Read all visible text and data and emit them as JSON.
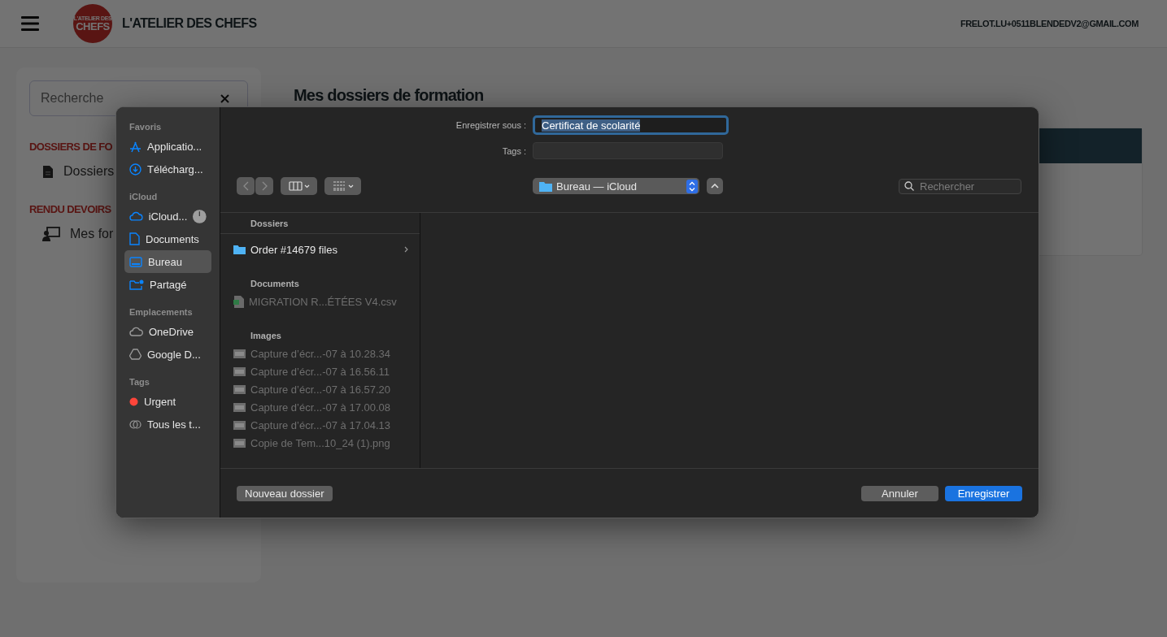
{
  "header": {
    "logo": {
      "line1": "L'ATELIER DES",
      "line2": "CHEFS"
    },
    "title": "L'ATELIER DES CHEFS",
    "email": "FRELOT.LU+0511BLENDEDV2@GMAIL.COM"
  },
  "sidebar": {
    "search": {
      "placeholder": "Recherche"
    },
    "sections": [
      {
        "title": "DOSSIERS DE FO",
        "items": [
          {
            "label": "Dossiers",
            "kind": "document"
          }
        ]
      },
      {
        "title": "RENDU DEVOIRS",
        "items": [
          {
            "label": "Mes for",
            "kind": "teacher"
          }
        ]
      }
    ]
  },
  "main": {
    "title": "Mes dossiers de formation"
  },
  "dialog": {
    "save_as": {
      "label": "Enregistrer sous :",
      "value": "Certificat de scolarité",
      "text_selected": true
    },
    "tags": {
      "label": "Tags :"
    },
    "location": "Bureau — iCloud",
    "search": {
      "placeholder": "Rechercher"
    },
    "places": [
      {
        "title": "Favoris",
        "items": [
          {
            "label": "Applicatio...",
            "kind": "apps",
            "selected": false
          },
          {
            "label": "Télécharg...",
            "kind": "download",
            "selected": false
          }
        ]
      },
      {
        "title": "iCloud",
        "items": [
          {
            "label": "iCloud...",
            "kind": "cloud",
            "selected": false,
            "progress": true
          },
          {
            "label": "Documents",
            "kind": "document",
            "selected": false
          },
          {
            "label": "Bureau",
            "kind": "desktop",
            "selected": true
          },
          {
            "label": "Partagé",
            "kind": "shared",
            "selected": false
          }
        ]
      },
      {
        "title": "Emplacements",
        "items": [
          {
            "label": "OneDrive",
            "kind": "cloud-grey",
            "selected": false
          },
          {
            "label": "Google D...",
            "kind": "drive",
            "selected": false
          }
        ]
      },
      {
        "title": "Tags",
        "items": [
          {
            "label": "Urgent",
            "kind": "tag",
            "color": "#ff453a",
            "selected": false
          },
          {
            "label": "Tous les t...",
            "kind": "all-tags",
            "selected": false
          }
        ]
      }
    ],
    "files": [
      {
        "title": "Dossiers",
        "items": [
          {
            "name": "Order #14679 files",
            "kind": "folder",
            "disabled": false
          }
        ]
      },
      {
        "title": "Documents",
        "items": [
          {
            "name": "MIGRATION R...ÉTÉES V4.csv",
            "kind": "sheet",
            "disabled": true
          }
        ]
      },
      {
        "title": "Images",
        "items": [
          {
            "name": "Capture d’écr...-07 à 10.28.34",
            "kind": "image",
            "disabled": true
          },
          {
            "name": "Capture d’écr...-07 à 16.56.11",
            "kind": "image",
            "disabled": true
          },
          {
            "name": "Capture d’écr...-07 à 16.57.20",
            "kind": "image",
            "disabled": true
          },
          {
            "name": "Capture d’écr...-07 à 17.00.08",
            "kind": "image",
            "disabled": true
          },
          {
            "name": "Capture d’écr...-07 à 17.04.13",
            "kind": "image",
            "disabled": true
          },
          {
            "name": "Copie de Tem...10_24 (1).png",
            "kind": "image",
            "disabled": true
          }
        ]
      }
    ],
    "new_folder": "Nouveau dossier",
    "buttons": [
      {
        "label": "Annuler",
        "primary": false
      },
      {
        "label": "Enregistrer",
        "primary": true
      }
    ]
  }
}
